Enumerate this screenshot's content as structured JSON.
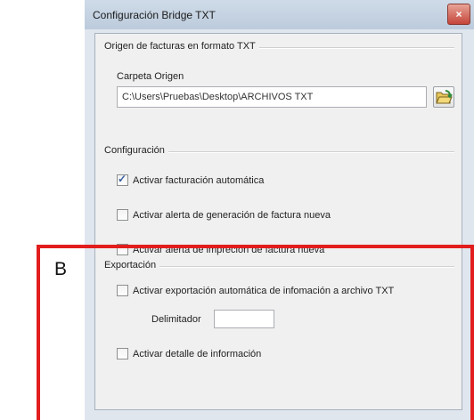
{
  "window": {
    "title": "Configuración Bridge TXT",
    "close_glyph": "×"
  },
  "origen": {
    "legend": "Origen de facturas en formato TXT",
    "folder_label": "Carpeta Origen",
    "folder_path": "C:\\Users\\Pruebas\\Desktop\\ARCHIVOS TXT"
  },
  "configuracion": {
    "legend": "Configuración",
    "items": [
      {
        "label": "Activar facturación automática",
        "checked": true
      },
      {
        "label": "Activar alerta de generación de factura nueva",
        "checked": false
      },
      {
        "label": "Activar alerta de impreción de factura nueva",
        "checked": false
      }
    ]
  },
  "exportacion": {
    "legend": "Exportación",
    "auto_label": "Activar exportación automática de infomación a archivo TXT",
    "auto_checked": false,
    "delimiter_label": "Delimitador",
    "delimiter_value": "",
    "detail_label": "Activar detalle de información",
    "detail_checked": false
  },
  "annotation": {
    "label": "B",
    "color": "#e21d1d"
  },
  "icons": {
    "folder": "folder-open-icon",
    "check": "✓"
  }
}
